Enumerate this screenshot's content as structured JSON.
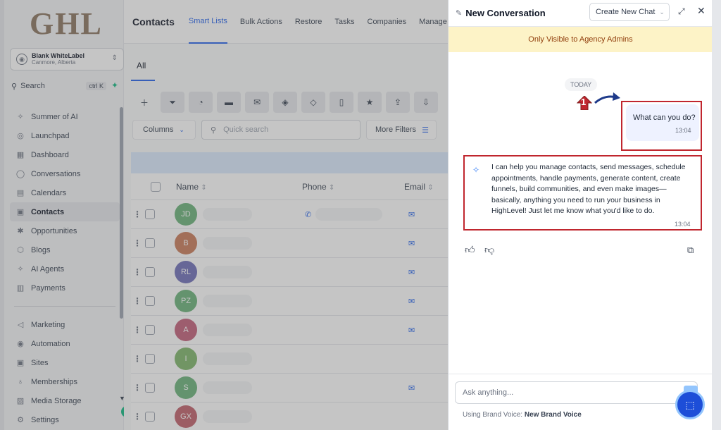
{
  "logo": "GHL",
  "account": {
    "name": "Blank WhiteLabel",
    "location": "Canmore, Alberta"
  },
  "sidebar_search": {
    "label": "Search",
    "shortcut": "ctrl K"
  },
  "nav": [
    {
      "label": "Summer of AI",
      "icon": "sparkle-icon",
      "glyph": "✧"
    },
    {
      "label": "Launchpad",
      "icon": "rocket-icon",
      "glyph": "◎"
    },
    {
      "label": "Dashboard",
      "icon": "dashboard-icon",
      "glyph": "▦"
    },
    {
      "label": "Conversations",
      "icon": "chat-icon",
      "glyph": "◯"
    },
    {
      "label": "Calendars",
      "icon": "calendar-icon",
      "glyph": "▤"
    },
    {
      "label": "Contacts",
      "icon": "contacts-icon",
      "glyph": "▣"
    },
    {
      "label": "Opportunities",
      "icon": "opportunities-icon",
      "glyph": "✱"
    },
    {
      "label": "Blogs",
      "icon": "blogs-icon",
      "glyph": "⬡"
    },
    {
      "label": "AI Agents",
      "icon": "ai-agents-icon",
      "glyph": "✧"
    },
    {
      "label": "Payments",
      "icon": "payments-icon",
      "glyph": "▥"
    }
  ],
  "nav2": [
    {
      "label": "Marketing",
      "icon": "marketing-icon",
      "glyph": "◁"
    },
    {
      "label": "Automation",
      "icon": "automation-icon",
      "glyph": "◉"
    },
    {
      "label": "Sites",
      "icon": "sites-icon",
      "glyph": "▣"
    },
    {
      "label": "Memberships",
      "icon": "memberships-icon",
      "glyph": "♁"
    },
    {
      "label": "Media Storage",
      "icon": "media-icon",
      "glyph": "▨"
    },
    {
      "label": "Settings",
      "icon": "gear-icon",
      "glyph": "⚙"
    }
  ],
  "topnav": {
    "title": "Contacts",
    "tabs": [
      "Smart Lists",
      "Bulk Actions",
      "Restore",
      "Tasks",
      "Companies",
      "Manage S"
    ]
  },
  "subtab": "All",
  "filters": {
    "columns": "Columns",
    "quick_search_placeholder": "Quick search",
    "more_filters": "More Filters"
  },
  "table": {
    "headers": {
      "name": "Name",
      "phone": "Phone",
      "email": "Email"
    },
    "rows": [
      {
        "initials": "JD",
        "color": "#6bb37a",
        "phone": true,
        "email": true
      },
      {
        "initials": "B",
        "color": "#c97b5a",
        "phone": false,
        "email": true
      },
      {
        "initials": "RL",
        "color": "#6f6fb8",
        "phone": false,
        "email": true
      },
      {
        "initials": "PZ",
        "color": "#6bb37a",
        "phone": false,
        "email": true
      },
      {
        "initials": "A",
        "color": "#c2607a",
        "phone": false,
        "email": true
      },
      {
        "initials": "I",
        "color": "#7fb56a",
        "phone": false,
        "email": false
      },
      {
        "initials": "S",
        "color": "#6bb37a",
        "phone": false,
        "email": true
      },
      {
        "initials": "GX",
        "color": "#c0606a",
        "phone": false,
        "email": false
      }
    ]
  },
  "chat": {
    "title": "New Conversation",
    "new_chat": "Create New Chat",
    "banner": "Only Visible to Agency Admins",
    "day_label": "TODAY",
    "marker_number": "1",
    "user_message": "What can you do?",
    "user_time": "13:04",
    "bot_message": "I can help you manage contacts, send messages, schedule appointments, handle payments, generate content, create funnels, build communities, and even make images—basically, anything you need to run your business in HighLevel! Just let me know what you'd like to do.",
    "bot_time": "13:04",
    "input_placeholder": "Ask anything...",
    "brand_voice_label": "Using Brand Voice:",
    "brand_voice_value": "New Brand Voice"
  },
  "colors": {
    "accent": "#2563eb",
    "highlight_box": "#c0262e",
    "banner_bg": "#fdf3c7"
  }
}
